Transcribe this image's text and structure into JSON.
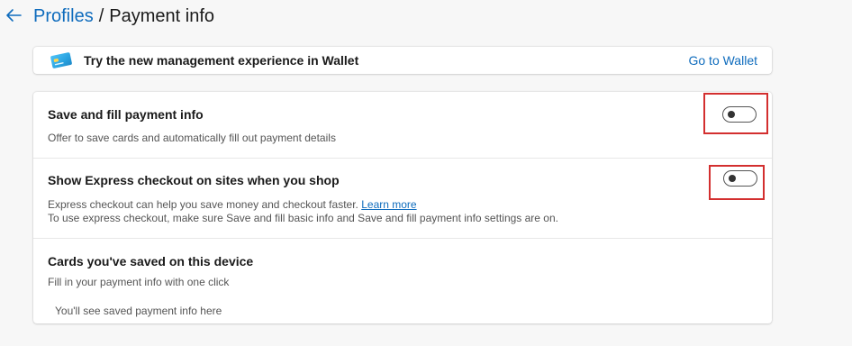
{
  "header": {
    "back_icon": "arrow-left-icon",
    "breadcrumb_parent": "Profiles",
    "breadcrumb_separator": "/",
    "breadcrumb_current": "Payment info"
  },
  "wallet_banner": {
    "icon": "wallet-card-icon",
    "text": "Try the new management experience in Wallet",
    "link": "Go to Wallet"
  },
  "settings": {
    "save_fill": {
      "title": "Save and fill payment info",
      "description": "Offer to save cards and automatically fill out payment details",
      "toggle_on": false
    },
    "express_checkout": {
      "title": "Show Express checkout on sites when you shop",
      "description_line1": "Express checkout can help you save money and checkout faster.",
      "learn_more": "Learn more",
      "description_line2": "To use express checkout, make sure Save and fill basic info and Save and fill payment info settings are on.",
      "toggle_on": false
    },
    "saved_cards": {
      "title": "Cards you've saved on this device",
      "description": "Fill in your payment info with one click",
      "empty_state": "You'll see saved payment info here"
    }
  },
  "colors": {
    "accent": "#0f6cbd",
    "highlight": "#d32f2f",
    "background": "#f7f7f7"
  }
}
